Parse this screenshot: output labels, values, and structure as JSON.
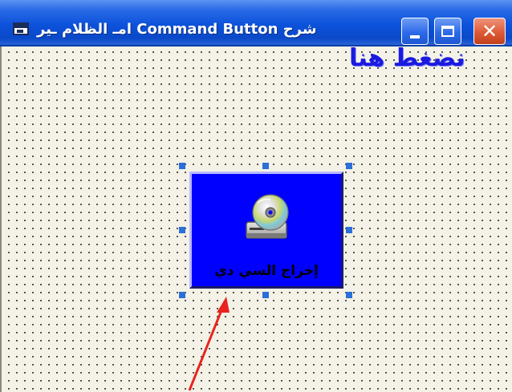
{
  "window": {
    "title": "شرح Command Button امـ الظلام ـير",
    "minimize_icon": "minimize-icon",
    "maximize_icon": "maximize-icon",
    "close_icon": "close-icon"
  },
  "form": {
    "hint_label": "نضغط هنا"
  },
  "command_button": {
    "caption": "إخراج السي دي",
    "icon": "cd-eject-icon",
    "background": "#0000ff"
  },
  "colors": {
    "titlebar": "#0c52db",
    "form_background": "#f4f2e6",
    "hint_text": "#1a1adf",
    "selection_handle": "#2b6fd9",
    "arrow": "#e8231f"
  }
}
